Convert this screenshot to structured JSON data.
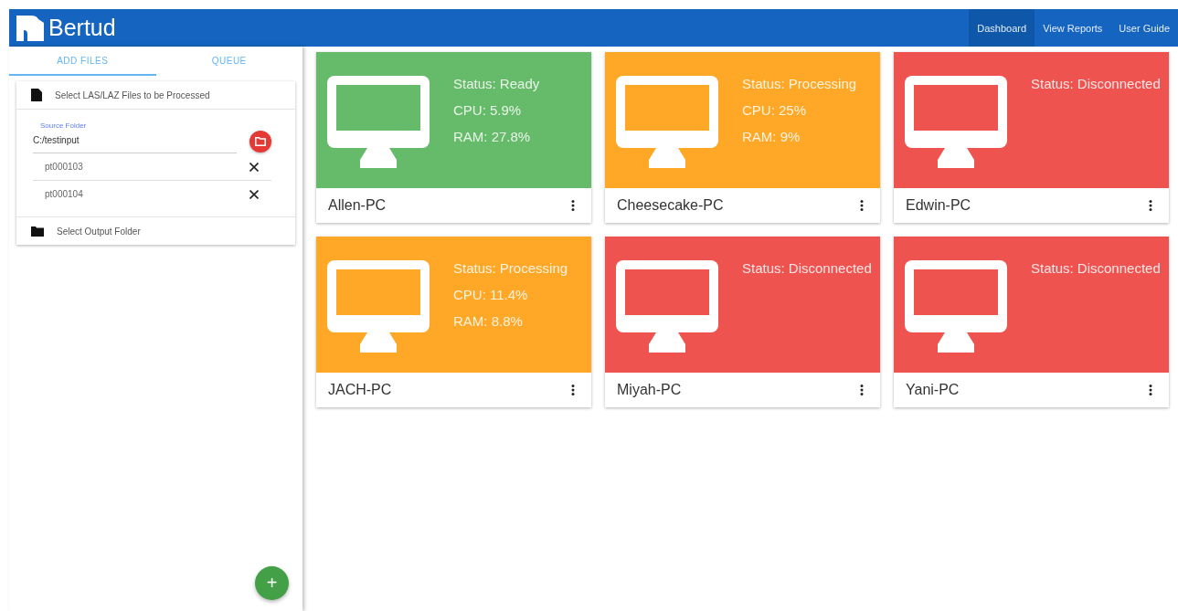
{
  "app": {
    "title": "Bertud"
  },
  "nav": [
    {
      "label": "Dashboard",
      "selected": true
    },
    {
      "label": "View Reports",
      "selected": false
    },
    {
      "label": "User Guide",
      "selected": false
    }
  ],
  "sidebar": {
    "tabs": [
      {
        "label": "ADD FILES",
        "selected": true
      },
      {
        "label": "QUEUE",
        "selected": false
      }
    ],
    "files_section": {
      "label": "Select LAS/LAZ Files to be Processed"
    },
    "source_folder": {
      "label": "Source Folder",
      "value": "C:/testinput"
    },
    "files": [
      "pt000103",
      "pt000104"
    ],
    "output_section": {
      "label": "Select Output Folder"
    },
    "add_button": "+"
  },
  "computers": [
    {
      "name": "Allen-PC",
      "color": "#66bb6a",
      "status": "Status: Ready",
      "cpu": "CPU: 5.9%",
      "ram": "RAM: 27.8%"
    },
    {
      "name": "Cheesecake-PC",
      "color": "#ffa726",
      "status": "Status: Processing",
      "cpu": "CPU: 25%",
      "ram": "RAM: 9%"
    },
    {
      "name": "Edwin-PC",
      "color": "#ef5350",
      "status": "Status: Disconnected"
    },
    {
      "name": "JACH-PC",
      "color": "#ffa726",
      "status": "Status: Processing",
      "cpu": "CPU: 11.4%",
      "ram": "RAM: 8.8%"
    },
    {
      "name": "Miyah-PC",
      "color": "#ef5350",
      "status": "Status: Disconnected"
    },
    {
      "name": "Yani-PC",
      "color": "#ef5350",
      "status": "Status: Disconnected"
    }
  ]
}
